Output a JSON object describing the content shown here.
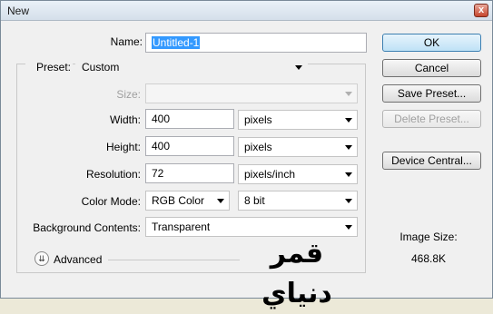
{
  "window": {
    "title": "New",
    "close_glyph": "x"
  },
  "fields": {
    "name_label": "Name:",
    "name_value": "Untitled-1",
    "preset_label": "Preset:",
    "preset_value": "Custom",
    "size_label": "Size:",
    "size_value": "",
    "width_label": "Width:",
    "width_value": "400",
    "width_unit": "pixels",
    "height_label": "Height:",
    "height_value": "400",
    "height_unit": "pixels",
    "resolution_label": "Resolution:",
    "resolution_value": "72",
    "resolution_unit": "pixels/inch",
    "colormode_label": "Color Mode:",
    "colormode_value": "RGB Color",
    "bitdepth_value": "8 bit",
    "background_label": "Background Contents:",
    "background_value": "Transparent"
  },
  "advanced": {
    "label": "Advanced",
    "icon": "chevron-double-down-icon"
  },
  "buttons": {
    "ok": "OK",
    "cancel": "Cancel",
    "save_preset": "Save Preset...",
    "delete_preset": "Delete Preset...",
    "device_central": "Device Central..."
  },
  "image_size": {
    "label": "Image Size:",
    "value": "468.8K"
  },
  "watermark": "قمر دنياي",
  "colors": {
    "selection": "#3399ff",
    "ok_border": "#3c7fb1"
  }
}
